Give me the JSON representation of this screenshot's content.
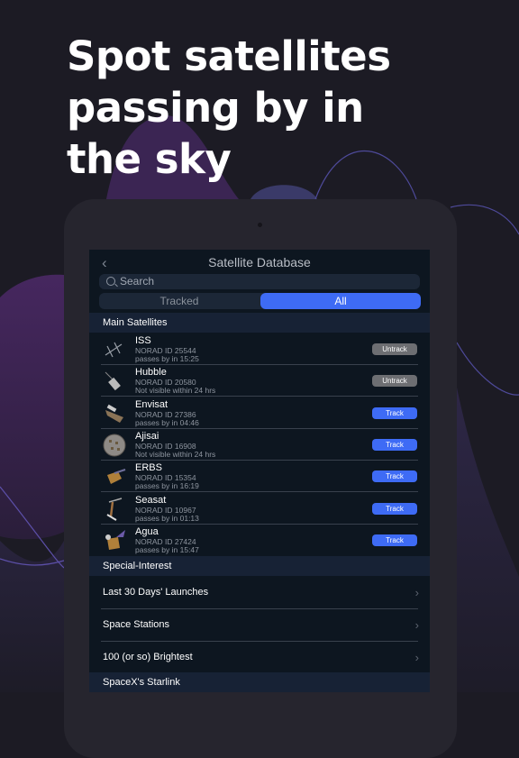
{
  "headline": "Spot satellites passing by in the sky",
  "colors": {
    "accent": "#3e6bf5",
    "untrack": "#6d6e72",
    "screen_bg": "#0d1620",
    "section_bg": "#172235",
    "page_bg": "#1c1b24"
  },
  "app": {
    "title": "Satellite Database",
    "back_icon": "chevron-left-icon",
    "search": {
      "placeholder": "Search",
      "icon": "search-icon"
    },
    "segments": [
      {
        "label": "Tracked",
        "selected": false
      },
      {
        "label": "All",
        "selected": true
      }
    ],
    "sections": [
      {
        "title": "Main Satellites",
        "items": [
          {
            "name": "ISS",
            "norad": "NORAD ID 25544",
            "status": "passes by in 15:25",
            "action": "Untrack"
          },
          {
            "name": "Hubble",
            "norad": "NORAD ID 20580",
            "status": "Not visible within 24 hrs",
            "action": "Untrack"
          },
          {
            "name": "Envisat",
            "norad": "NORAD ID 27386",
            "status": "passes by in 04:46",
            "action": "Track"
          },
          {
            "name": "Ajisai",
            "norad": "NORAD ID 16908",
            "status": "Not visible within 24 hrs",
            "action": "Track"
          },
          {
            "name": "ERBS",
            "norad": "NORAD ID 15354",
            "status": "passes by in 16:19",
            "action": "Track"
          },
          {
            "name": "Seasat",
            "norad": "NORAD ID 10967",
            "status": "passes by in 01:13",
            "action": "Track"
          },
          {
            "name": "Agua",
            "norad": "NORAD ID 27424",
            "status": "passes by in 15:47",
            "action": "Track"
          }
        ]
      },
      {
        "title": "Special-Interest",
        "links": [
          "Last 30 Days' Launches",
          "Space Stations",
          "100 (or so) Brightest"
        ]
      },
      {
        "title": "SpaceX's Starlink"
      }
    ]
  }
}
